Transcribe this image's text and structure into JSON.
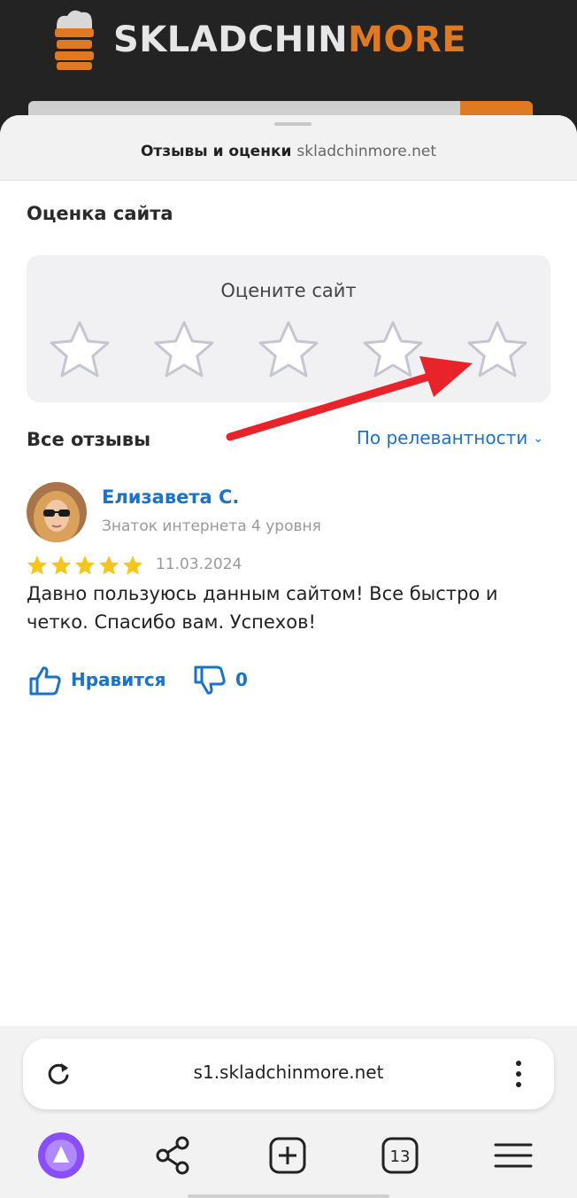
{
  "site": {
    "brand_light": "SKLADCHIN",
    "brand_accent": "MORE",
    "brand_accent_color": "#e07a22"
  },
  "sheet": {
    "title": "Отзывы и оценки",
    "domain": "skladchinmore.net"
  },
  "rating": {
    "section_title": "Оценка сайта",
    "prompt": "Оцените сайт",
    "star_count": 5
  },
  "reviews": {
    "section_title": "Все отзывы",
    "sort_label": "По релевантности",
    "sort_icon": "chevron-down-icon",
    "items": [
      {
        "author": "Елизавета С.",
        "status": "Знаток интернета 4 уровня",
        "stars": 5,
        "date": "11.03.2024",
        "text": "Давно пользуюсь данным сайтом! Все быстро и четко. Спасибо вам. Успехов!",
        "like_label": "Нравится",
        "dislike_count": "0"
      }
    ]
  },
  "browser": {
    "url": "s1.skladchinmore.net",
    "tab_count": "13",
    "icons": [
      "reload-icon",
      "more-vertical-icon",
      "alice-icon",
      "share-icon",
      "new-tab-icon",
      "tabs-icon",
      "menu-icon"
    ]
  },
  "colors": {
    "link": "#1a73c9",
    "star_filled": "#f5c518",
    "arrow": "#e8232a",
    "assistant": "#8a4dff"
  }
}
